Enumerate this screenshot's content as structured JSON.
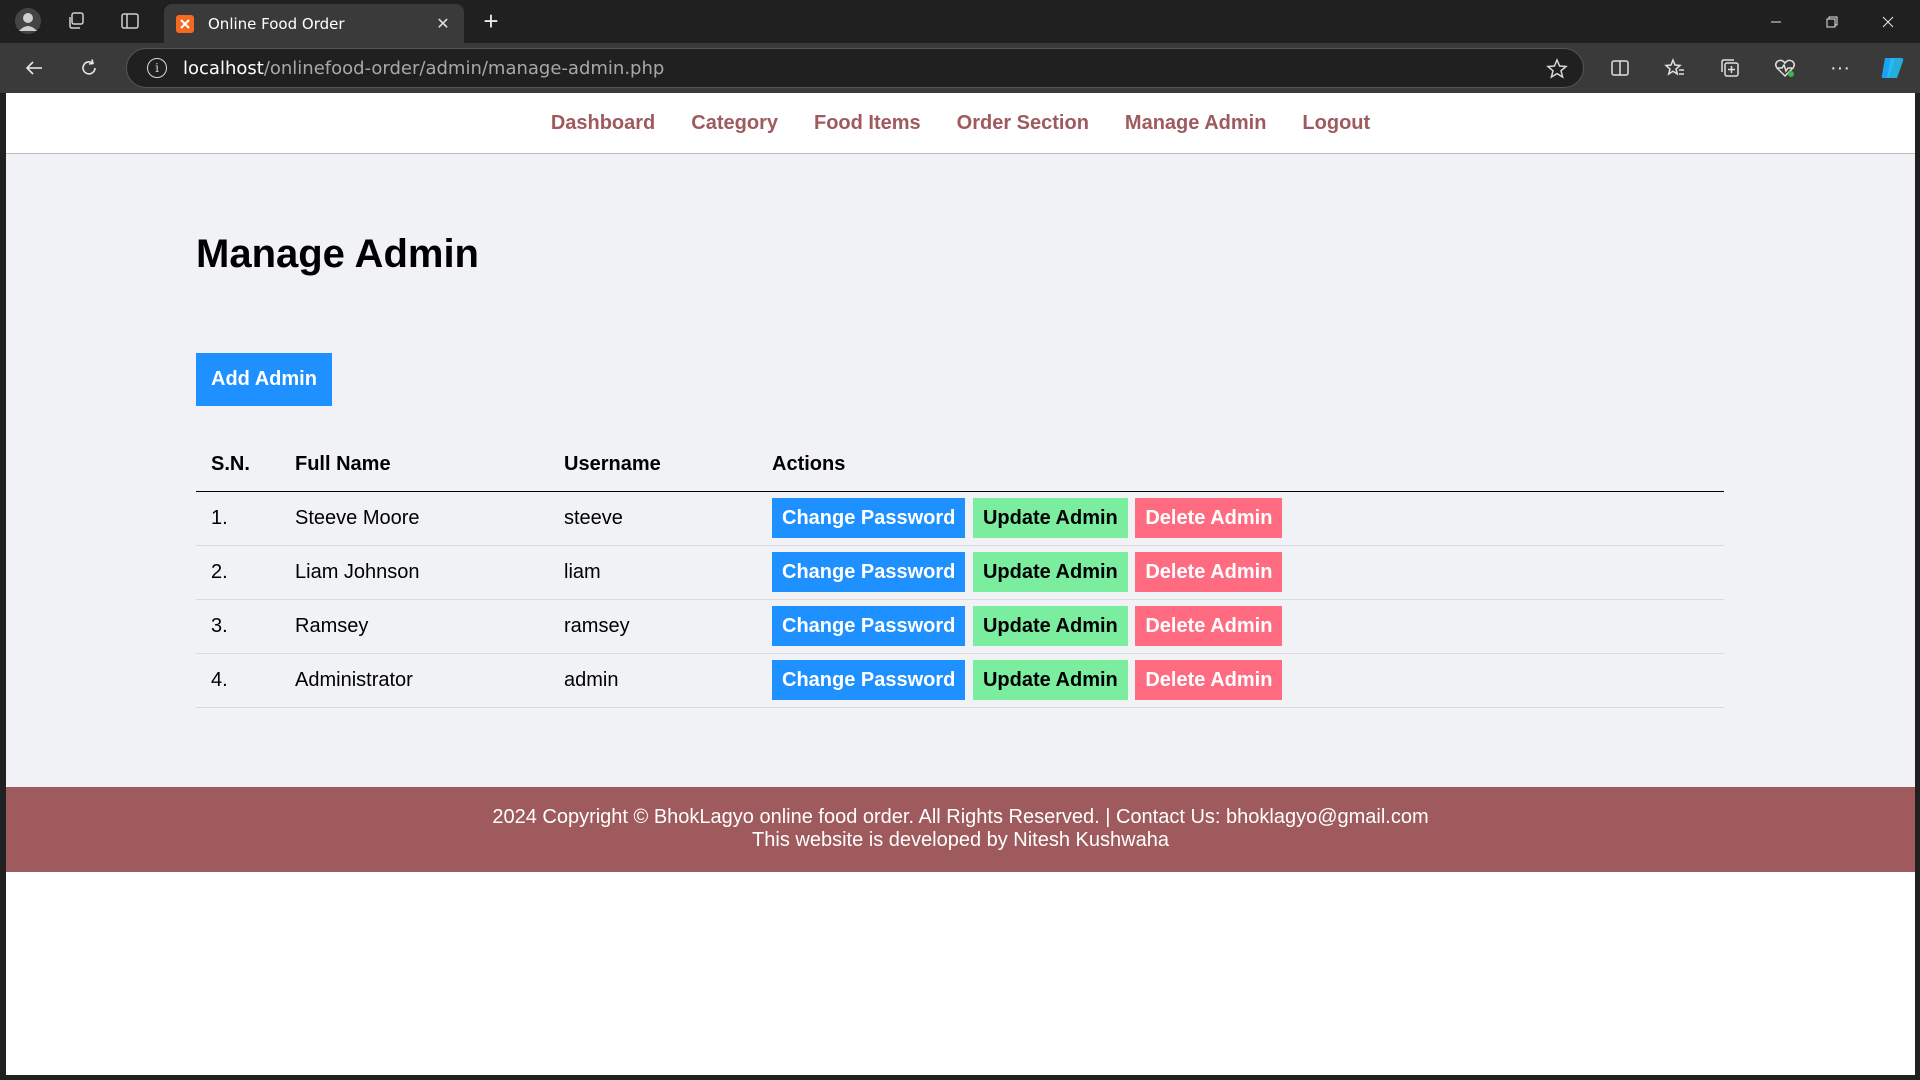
{
  "browser": {
    "tab_title": "Online Food Order",
    "url_host": "localhost",
    "url_path": "/onlinefood-order/admin/manage-admin.php"
  },
  "menu": {
    "items": [
      {
        "label": "Dashboard"
      },
      {
        "label": "Category"
      },
      {
        "label": "Food Items"
      },
      {
        "label": "Order Section"
      },
      {
        "label": "Manage Admin"
      },
      {
        "label": "Logout"
      }
    ]
  },
  "page": {
    "title": "Manage Admin",
    "add_button": "Add Admin"
  },
  "table": {
    "headers": [
      "S.N.",
      "Full Name",
      "Username",
      "Actions"
    ],
    "rows": [
      {
        "sn": "1.",
        "full_name": "Steeve Moore",
        "username": "steeve"
      },
      {
        "sn": "2.",
        "full_name": "Liam Johnson",
        "username": "liam"
      },
      {
        "sn": "3.",
        "full_name": "Ramsey",
        "username": "ramsey"
      },
      {
        "sn": "4.",
        "full_name": "Administrator",
        "username": "admin"
      }
    ],
    "actions": {
      "change_password": "Change Password",
      "update": "Update Admin",
      "delete": "Delete Admin"
    }
  },
  "footer": {
    "line1": "2024 Copyright © BhokLagyo online food order. All Rights Reserved. | Contact Us: bhoklagyo@gmail.com",
    "line2": "This website is developed by Nitesh Kushwaha"
  },
  "colors": {
    "brand": "#9e5a5c",
    "primary": "#1e90ff",
    "success": "#7bed9f",
    "danger": "#ff6b81",
    "page_bg": "#f1f2f6"
  }
}
